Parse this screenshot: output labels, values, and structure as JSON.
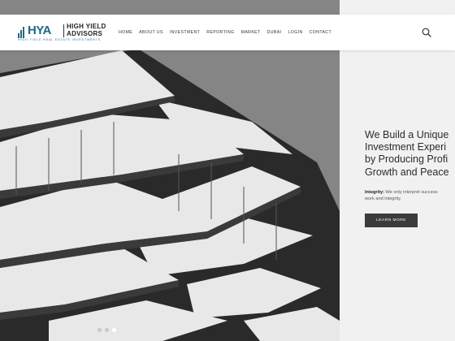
{
  "brand": {
    "letters": "HYA",
    "name_line1": "HIGH YIELD",
    "name_line2": "ADVISORS",
    "tagline": "HIGH YIELD REAL ESTATE INVESTMENTS",
    "color": "#1b6a8a"
  },
  "nav": {
    "items": [
      "HOME",
      "ABOUT US",
      "INVESTMENT",
      "REPORTING",
      "MARKET",
      "DUBAI",
      "LOGIN",
      "CONTACT"
    ]
  },
  "search": {
    "icon": "search-icon"
  },
  "hero": {
    "headline": [
      "We Build a Unique",
      "Investment Experi",
      "by Producing Profi",
      "Growth and Peace"
    ],
    "integrity_label": "Integrity:",
    "integrity_text_1": " We only interpret success",
    "integrity_text_2": "work and integrity.",
    "cta_label": "LEARN MORE",
    "slider": {
      "count": 3,
      "active": 3
    }
  }
}
